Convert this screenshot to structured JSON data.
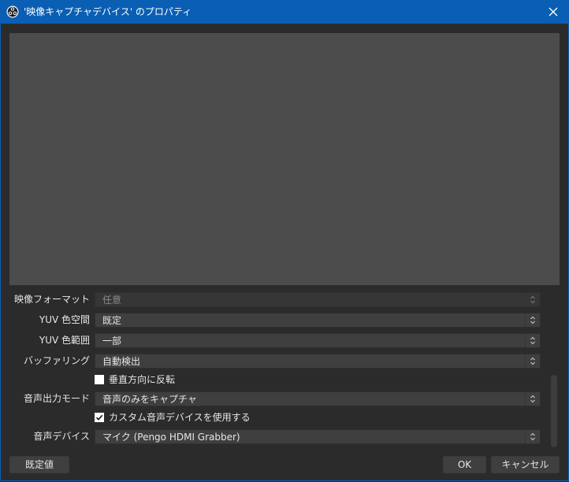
{
  "window": {
    "title": "'映像キャプチャデバイス' のプロパティ",
    "accent_color": "#0a5fb4",
    "icons": {
      "app": "obs-logo-icon",
      "close": "close-icon"
    }
  },
  "properties": {
    "video_format": {
      "label": "映像フォーマット",
      "value": "任意",
      "disabled": true
    },
    "yuv_color_space": {
      "label": "YUV 色空間",
      "value": "既定"
    },
    "yuv_color_range": {
      "label": "YUV 色範囲",
      "value": "一部"
    },
    "buffering": {
      "label": "バッファリング",
      "value": "自動検出"
    },
    "flip_vertical": {
      "label": "垂直方向に反転",
      "checked": false
    },
    "audio_output_mode": {
      "label": "音声出力モード",
      "value": "音声のみをキャプチャ"
    },
    "custom_audio_device": {
      "label": "カスタム音声デバイスを使用する",
      "checked": true
    },
    "audio_device": {
      "label": "音声デバイス",
      "value": "マイク (Pengo HDMI Grabber)"
    }
  },
  "buttons": {
    "defaults": "既定値",
    "ok": "OK",
    "cancel": "キャンセル"
  }
}
